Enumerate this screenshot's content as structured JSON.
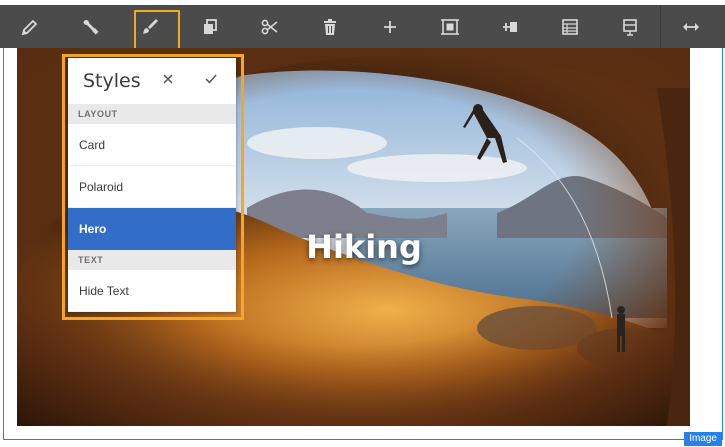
{
  "toolbar": {
    "buttons": [
      {
        "name": "edit-button",
        "icon": "pencil-icon"
      },
      {
        "name": "configure-button",
        "icon": "wrench-icon"
      },
      {
        "name": "styles-button",
        "icon": "paintbrush-icon",
        "active": true
      },
      {
        "name": "copy-button",
        "icon": "copy-icon"
      },
      {
        "name": "cut-button",
        "icon": "scissors-icon"
      },
      {
        "name": "delete-button",
        "icon": "trash-icon"
      },
      {
        "name": "insert-button",
        "icon": "plus-icon"
      },
      {
        "name": "group-button",
        "icon": "group-icon"
      },
      {
        "name": "parent-button",
        "icon": "parent-icon"
      },
      {
        "name": "layout-button",
        "icon": "layout-icon"
      },
      {
        "name": "target-button",
        "icon": "target-icon"
      },
      {
        "name": "resize-button",
        "icon": "resize-icon"
      }
    ],
    "accent": "#f5a623",
    "background": "#4b4b4b"
  },
  "styles_popover": {
    "title": "Styles",
    "close_icon": "close-icon",
    "confirm_icon": "checkmark-icon",
    "sections": [
      {
        "label": "LAYOUT",
        "items": [
          {
            "label": "Card",
            "selected": false
          },
          {
            "label": "Polaroid",
            "selected": false
          },
          {
            "label": "Hero",
            "selected": true
          }
        ]
      },
      {
        "label": "TEXT",
        "items": [
          {
            "label": "Hide Text",
            "selected": false
          }
        ]
      }
    ],
    "selected_color": "#326ec8"
  },
  "component": {
    "hero_title": "Hiking",
    "badge": "Image",
    "frame_color": "#2680eb"
  }
}
